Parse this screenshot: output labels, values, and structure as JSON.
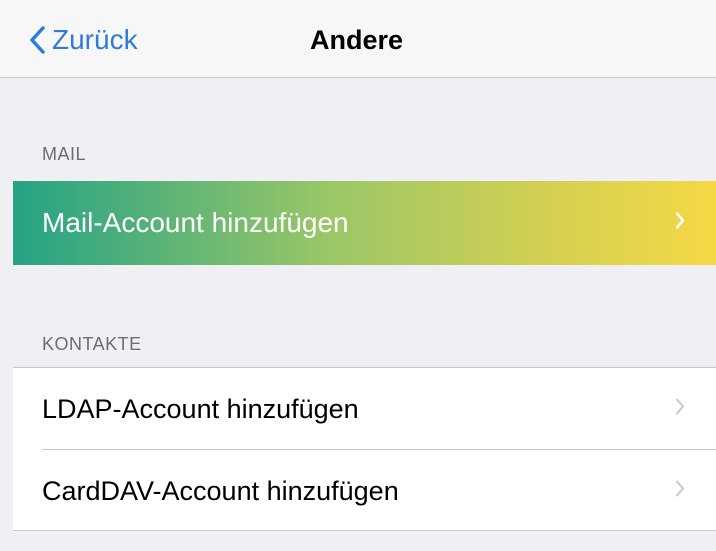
{
  "navbar": {
    "back_label": "Zurück",
    "title": "Andere"
  },
  "sections": {
    "mail": {
      "header": "MAIL",
      "items": [
        {
          "label": "Mail-Account hinzufügen",
          "icon": "chevron-right-icon"
        }
      ]
    },
    "kontakte": {
      "header": "KONTAKTE",
      "items": [
        {
          "label": "LDAP-Account hinzufügen",
          "icon": "chevron-right-icon"
        },
        {
          "label": "CardDAV-Account hinzufügen",
          "icon": "chevron-right-icon"
        }
      ]
    }
  },
  "colors": {
    "accent": "#2f7bd9",
    "background": "#efeff4",
    "highlight_gradient_start": "#25a386",
    "highlight_gradient_end": "#f5d845"
  }
}
